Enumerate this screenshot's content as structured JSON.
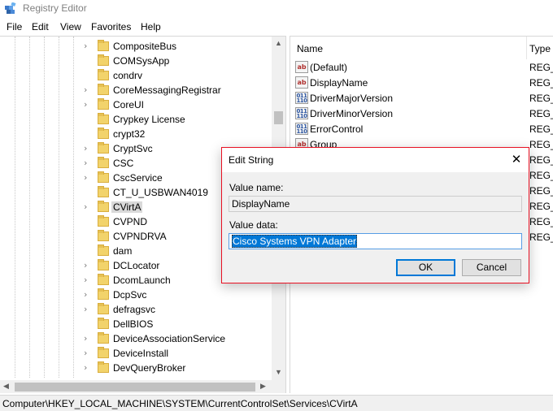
{
  "window": {
    "title": "Registry Editor"
  },
  "menu": [
    "File",
    "Edit",
    "View",
    "Favorites",
    "Help"
  ],
  "tree": {
    "items": [
      {
        "label": "CompositeBus",
        "expandable": true
      },
      {
        "label": "COMSysApp",
        "expandable": false
      },
      {
        "label": "condrv",
        "expandable": false
      },
      {
        "label": "CoreMessagingRegistrar",
        "expandable": true
      },
      {
        "label": "CoreUI",
        "expandable": true
      },
      {
        "label": "Crypkey License",
        "expandable": false
      },
      {
        "label": "crypt32",
        "expandable": false
      },
      {
        "label": "CryptSvc",
        "expandable": true
      },
      {
        "label": "CSC",
        "expandable": true
      },
      {
        "label": "CscService",
        "expandable": true
      },
      {
        "label": "CT_U_USBWAN4019",
        "expandable": false
      },
      {
        "label": "CVirtA",
        "expandable": true,
        "selected": true
      },
      {
        "label": "CVPND",
        "expandable": false
      },
      {
        "label": "CVPNDRVA",
        "expandable": false
      },
      {
        "label": "dam",
        "expandable": false
      },
      {
        "label": "DCLocator",
        "expandable": true
      },
      {
        "label": "DcomLaunch",
        "expandable": true
      },
      {
        "label": "DcpSvc",
        "expandable": true
      },
      {
        "label": "defragsvc",
        "expandable": true
      },
      {
        "label": "DellBIOS",
        "expandable": false
      },
      {
        "label": "DeviceAssociationService",
        "expandable": true
      },
      {
        "label": "DeviceInstall",
        "expandable": true
      },
      {
        "label": "DevQueryBroker",
        "expandable": true
      }
    ]
  },
  "list": {
    "columns": {
      "name": "Name",
      "type": "Type"
    },
    "rows": [
      {
        "icon": "string-value-icon",
        "glyph": "ab",
        "name": "(Default)",
        "type": "REG_S"
      },
      {
        "icon": "string-value-icon",
        "glyph": "ab",
        "name": "DisplayName",
        "type": "REG_S"
      },
      {
        "icon": "binary-value-icon",
        "glyph": "011\n110",
        "name": "DriverMajorVersion",
        "type": "REG_D"
      },
      {
        "icon": "binary-value-icon",
        "glyph": "011\n110",
        "name": "DriverMinorVersion",
        "type": "REG_D"
      },
      {
        "icon": "binary-value-icon",
        "glyph": "011\n110",
        "name": "ErrorControl",
        "type": "REG_D"
      },
      {
        "icon": "string-value-icon",
        "glyph": "ab",
        "name": "Group",
        "type": "REG_S"
      },
      {
        "icon": "",
        "glyph": "",
        "name": "",
        "type": "REG_E"
      },
      {
        "icon": "",
        "glyph": "",
        "name": "",
        "type": "REG_D"
      },
      {
        "icon": "",
        "glyph": "",
        "name": "",
        "type": "REG_M"
      },
      {
        "icon": "",
        "glyph": "",
        "name": "",
        "type": "REG_D"
      },
      {
        "icon": "",
        "glyph": "",
        "name": "",
        "type": "REG_D"
      },
      {
        "icon": "",
        "glyph": "",
        "name": "",
        "type": "REG_D"
      }
    ]
  },
  "dialog": {
    "title": "Edit String",
    "value_name_label": "Value name:",
    "value_name": "DisplayName",
    "value_data_label": "Value data:",
    "value_data": "Cisco Systems VPN Adapter",
    "ok_label": "OK",
    "cancel_label": "Cancel",
    "close_glyph": "✕"
  },
  "status": {
    "path": "Computer\\HKEY_LOCAL_MACHINE\\SYSTEM\\CurrentControlSet\\Services\\CVirtA"
  },
  "colors": {
    "accent": "#0078d7",
    "dialog_border": "#e81123",
    "folder": "#f2d36b"
  }
}
